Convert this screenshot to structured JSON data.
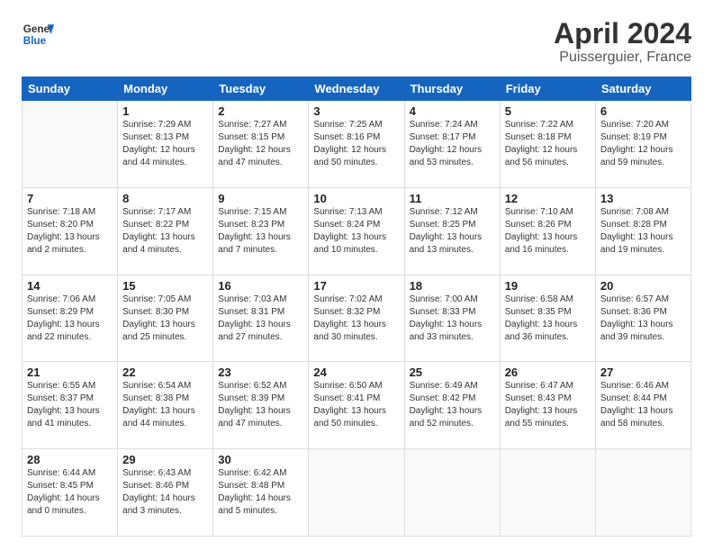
{
  "header": {
    "logo_line1": "General",
    "logo_line2": "Blue",
    "month": "April 2024",
    "location": "Puisserguier, France"
  },
  "days_of_week": [
    "Sunday",
    "Monday",
    "Tuesday",
    "Wednesday",
    "Thursday",
    "Friday",
    "Saturday"
  ],
  "weeks": [
    [
      {
        "day": "",
        "info": ""
      },
      {
        "day": "1",
        "info": "Sunrise: 7:29 AM\nSunset: 8:13 PM\nDaylight: 12 hours\nand 44 minutes."
      },
      {
        "day": "2",
        "info": "Sunrise: 7:27 AM\nSunset: 8:15 PM\nDaylight: 12 hours\nand 47 minutes."
      },
      {
        "day": "3",
        "info": "Sunrise: 7:25 AM\nSunset: 8:16 PM\nDaylight: 12 hours\nand 50 minutes."
      },
      {
        "day": "4",
        "info": "Sunrise: 7:24 AM\nSunset: 8:17 PM\nDaylight: 12 hours\nand 53 minutes."
      },
      {
        "day": "5",
        "info": "Sunrise: 7:22 AM\nSunset: 8:18 PM\nDaylight: 12 hours\nand 56 minutes."
      },
      {
        "day": "6",
        "info": "Sunrise: 7:20 AM\nSunset: 8:19 PM\nDaylight: 12 hours\nand 59 minutes."
      }
    ],
    [
      {
        "day": "7",
        "info": "Sunrise: 7:18 AM\nSunset: 8:20 PM\nDaylight: 13 hours\nand 2 minutes."
      },
      {
        "day": "8",
        "info": "Sunrise: 7:17 AM\nSunset: 8:22 PM\nDaylight: 13 hours\nand 4 minutes."
      },
      {
        "day": "9",
        "info": "Sunrise: 7:15 AM\nSunset: 8:23 PM\nDaylight: 13 hours\nand 7 minutes."
      },
      {
        "day": "10",
        "info": "Sunrise: 7:13 AM\nSunset: 8:24 PM\nDaylight: 13 hours\nand 10 minutes."
      },
      {
        "day": "11",
        "info": "Sunrise: 7:12 AM\nSunset: 8:25 PM\nDaylight: 13 hours\nand 13 minutes."
      },
      {
        "day": "12",
        "info": "Sunrise: 7:10 AM\nSunset: 8:26 PM\nDaylight: 13 hours\nand 16 minutes."
      },
      {
        "day": "13",
        "info": "Sunrise: 7:08 AM\nSunset: 8:28 PM\nDaylight: 13 hours\nand 19 minutes."
      }
    ],
    [
      {
        "day": "14",
        "info": "Sunrise: 7:06 AM\nSunset: 8:29 PM\nDaylight: 13 hours\nand 22 minutes."
      },
      {
        "day": "15",
        "info": "Sunrise: 7:05 AM\nSunset: 8:30 PM\nDaylight: 13 hours\nand 25 minutes."
      },
      {
        "day": "16",
        "info": "Sunrise: 7:03 AM\nSunset: 8:31 PM\nDaylight: 13 hours\nand 27 minutes."
      },
      {
        "day": "17",
        "info": "Sunrise: 7:02 AM\nSunset: 8:32 PM\nDaylight: 13 hours\nand 30 minutes."
      },
      {
        "day": "18",
        "info": "Sunrise: 7:00 AM\nSunset: 8:33 PM\nDaylight: 13 hours\nand 33 minutes."
      },
      {
        "day": "19",
        "info": "Sunrise: 6:58 AM\nSunset: 8:35 PM\nDaylight: 13 hours\nand 36 minutes."
      },
      {
        "day": "20",
        "info": "Sunrise: 6:57 AM\nSunset: 8:36 PM\nDaylight: 13 hours\nand 39 minutes."
      }
    ],
    [
      {
        "day": "21",
        "info": "Sunrise: 6:55 AM\nSunset: 8:37 PM\nDaylight: 13 hours\nand 41 minutes."
      },
      {
        "day": "22",
        "info": "Sunrise: 6:54 AM\nSunset: 8:38 PM\nDaylight: 13 hours\nand 44 minutes."
      },
      {
        "day": "23",
        "info": "Sunrise: 6:52 AM\nSunset: 8:39 PM\nDaylight: 13 hours\nand 47 minutes."
      },
      {
        "day": "24",
        "info": "Sunrise: 6:50 AM\nSunset: 8:41 PM\nDaylight: 13 hours\nand 50 minutes."
      },
      {
        "day": "25",
        "info": "Sunrise: 6:49 AM\nSunset: 8:42 PM\nDaylight: 13 hours\nand 52 minutes."
      },
      {
        "day": "26",
        "info": "Sunrise: 6:47 AM\nSunset: 8:43 PM\nDaylight: 13 hours\nand 55 minutes."
      },
      {
        "day": "27",
        "info": "Sunrise: 6:46 AM\nSunset: 8:44 PM\nDaylight: 13 hours\nand 58 minutes."
      }
    ],
    [
      {
        "day": "28",
        "info": "Sunrise: 6:44 AM\nSunset: 8:45 PM\nDaylight: 14 hours\nand 0 minutes."
      },
      {
        "day": "29",
        "info": "Sunrise: 6:43 AM\nSunset: 8:46 PM\nDaylight: 14 hours\nand 3 minutes."
      },
      {
        "day": "30",
        "info": "Sunrise: 6:42 AM\nSunset: 8:48 PM\nDaylight: 14 hours\nand 5 minutes."
      },
      {
        "day": "",
        "info": ""
      },
      {
        "day": "",
        "info": ""
      },
      {
        "day": "",
        "info": ""
      },
      {
        "day": "",
        "info": ""
      }
    ]
  ]
}
